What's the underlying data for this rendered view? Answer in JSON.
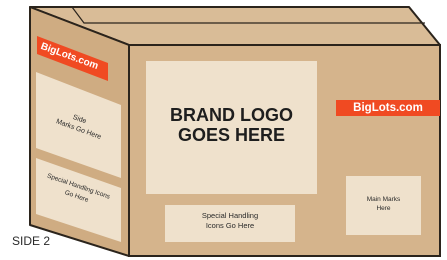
{
  "colors": {
    "cardboard_front": "#d5b48c",
    "cardboard_side": "#cfac82",
    "cardboard_top": "#d9bc97",
    "panel": "#efe1cc",
    "outline": "#2b241c",
    "logo_red": "#f04a22"
  },
  "front": {
    "brand_logo_line1": "BRAND LOGO",
    "brand_logo_line2": "GOES HERE",
    "logo": "BigLots.com",
    "special_handling_line1": "Special Handling",
    "special_handling_line2": "Icons Go Here",
    "main_marks_line1": "Main Marks",
    "main_marks_line2": "Here"
  },
  "side": {
    "logo": "BigLots.com",
    "side_marks_line1": "Side",
    "side_marks_line2": "Marks Go Here",
    "special_handling_line1": "Special Handling Icons",
    "special_handling_line2": "Go Here",
    "label": "SIDE 2"
  }
}
